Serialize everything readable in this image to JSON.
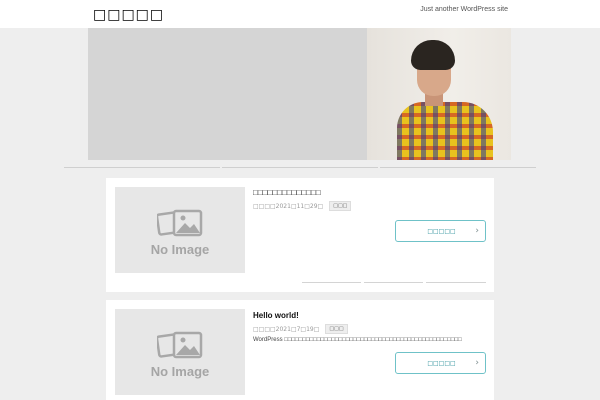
{
  "header": {
    "site_title": "□□□□□",
    "tagline": "Just another WordPress site"
  },
  "hero": {
    "image": "person-photo"
  },
  "posts": [
    {
      "title": "□□□□□□□□□□□□□□",
      "date": "□□□□2021□11□29□",
      "category": "□□□",
      "excerpt": "",
      "thumbnail_text": "No Image",
      "read_more": "□□□□□",
      "read_more_icon": "chevron-right-icon"
    },
    {
      "title": "Hello world!",
      "date": "□□□□2021□7□19□",
      "category": "□□□",
      "excerpt": "WordPress □□□□□□□□□□□□□□□□□□□□□□□□□□□□□□□□□□□□□□□□□□□□□□□□□",
      "thumbnail_text": "No Image",
      "read_more": "□□□□□",
      "read_more_icon": "chevron-right-icon"
    }
  ],
  "colors": {
    "accent": "#6fc2c8",
    "background": "#eeeeee",
    "card": "#ffffff"
  }
}
